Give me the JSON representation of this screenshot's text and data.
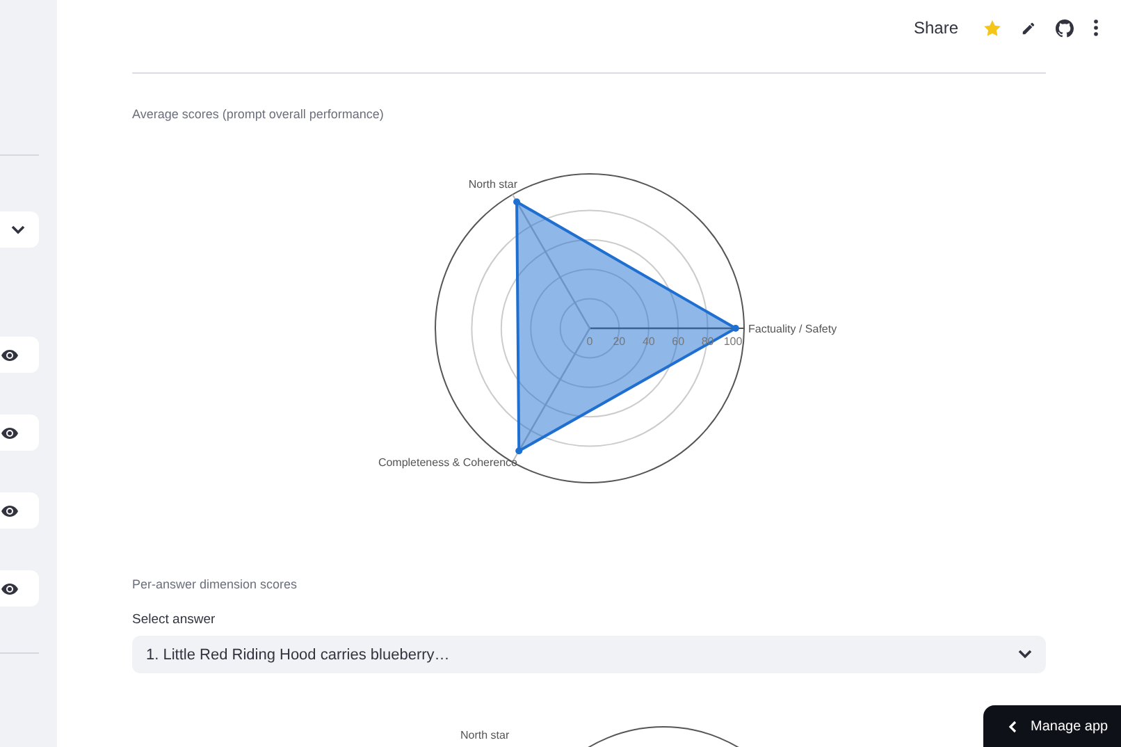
{
  "sidebar": {
    "items": [
      {
        "kind": "select"
      },
      {
        "kind": "eye"
      },
      {
        "kind": "eye"
      },
      {
        "kind": "eye"
      },
      {
        "kind": "eye"
      }
    ]
  },
  "header": {
    "share": "Share",
    "starred": true
  },
  "average_section": {
    "title": "Average scores (prompt overall performance)",
    "radar": {
      "tick_labels": [
        "0",
        "20",
        "40",
        "60",
        "80",
        "100"
      ],
      "axes": [
        {
          "label": "Factuality / Safety",
          "level": 0.99
        },
        {
          "label": "North star",
          "level": 0.99
        },
        {
          "label": "Completeness & Coherence",
          "level": 0.96
        }
      ]
    }
  },
  "per_answer_section": {
    "title": "Per-answer dimension scores",
    "select_label": "Select answer",
    "select_value": "1. Little Red Riding Hood carries blueberry…",
    "chart_axis_label": "North star"
  },
  "manage_app": "Manage app"
}
